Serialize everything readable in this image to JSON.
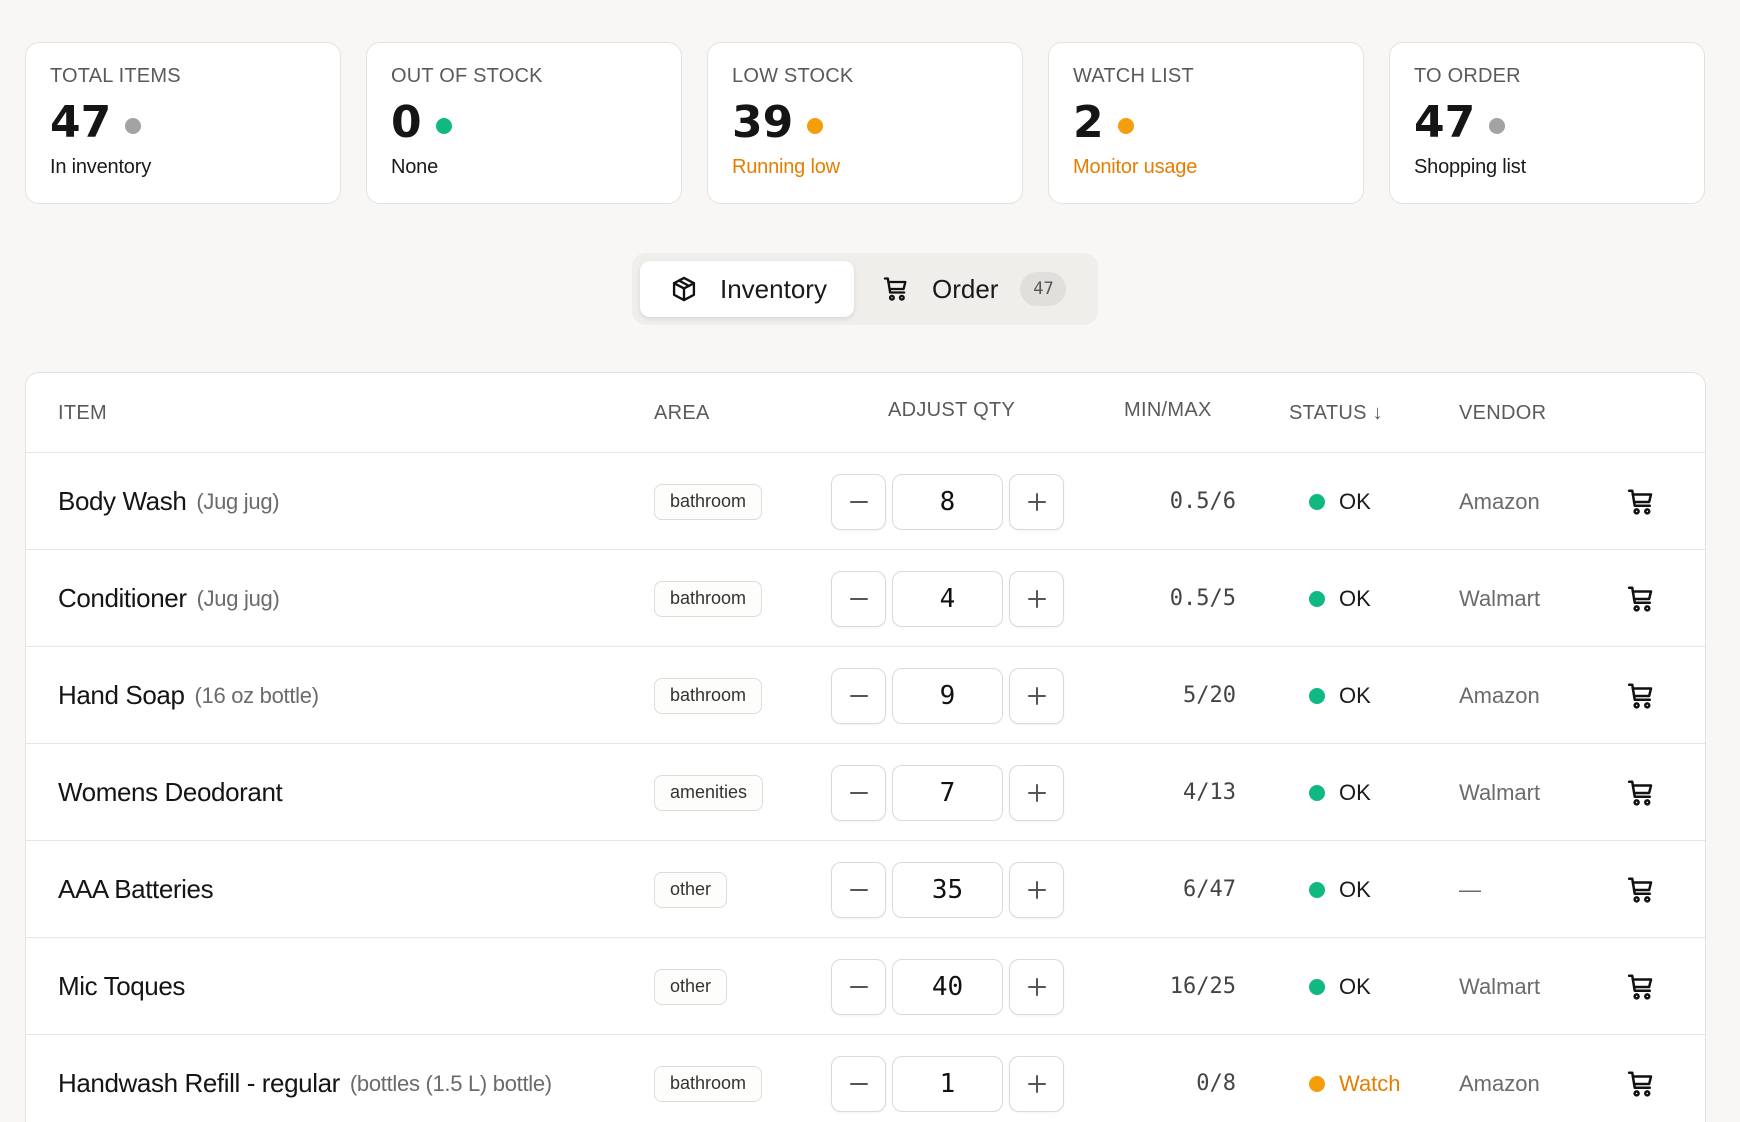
{
  "colors": {
    "green": "#10b981",
    "orange": "#f59e0b",
    "gray": "#a3a3a3",
    "orange_text": "#e67e00"
  },
  "stats": [
    {
      "label": "TOTAL ITEMS",
      "value": "47",
      "dot": "#a3a3a3",
      "sub": "In inventory",
      "sub_color": "#1a1a1a"
    },
    {
      "label": "OUT OF STOCK",
      "value": "0",
      "dot": "#10b981",
      "sub": "None",
      "sub_color": "#1a1a1a"
    },
    {
      "label": "LOW STOCK",
      "value": "39",
      "dot": "#f59e0b",
      "sub": "Running low",
      "sub_color": "#e67e00"
    },
    {
      "label": "WATCH LIST",
      "value": "2",
      "dot": "#f59e0b",
      "sub": "Monitor usage",
      "sub_color": "#e67e00"
    },
    {
      "label": "TO ORDER",
      "value": "47",
      "dot": "#a3a3a3",
      "sub": "Shopping list",
      "sub_color": "#1a1a1a"
    }
  ],
  "tabs": {
    "inventory": {
      "label": "Inventory",
      "icon": "box-icon"
    },
    "order": {
      "label": "Order",
      "icon": "cart-icon",
      "count": "47"
    }
  },
  "table": {
    "headers": {
      "item": "ITEM",
      "area": "AREA",
      "adjust": "ADJUST QTY",
      "minmax": "MIN/MAX",
      "status": "STATUS ↓",
      "vendor": "VENDOR"
    },
    "rows": [
      {
        "name": "Body Wash",
        "unit": "(Jug jug)",
        "area": "bathroom",
        "qty": "8",
        "minmax": "0.5/6",
        "status": "OK",
        "status_color": "#10b981",
        "status_text_color": "#1a1a1a",
        "vendor": "Amazon"
      },
      {
        "name": "Conditioner",
        "unit": "(Jug jug)",
        "area": "bathroom",
        "qty": "4",
        "minmax": "0.5/5",
        "status": "OK",
        "status_color": "#10b981",
        "status_text_color": "#1a1a1a",
        "vendor": "Walmart"
      },
      {
        "name": "Hand Soap",
        "unit": "(16 oz bottle)",
        "area": "bathroom",
        "qty": "9",
        "minmax": "5/20",
        "status": "OK",
        "status_color": "#10b981",
        "status_text_color": "#1a1a1a",
        "vendor": "Amazon"
      },
      {
        "name": "Womens Deodorant",
        "unit": "",
        "area": "amenities",
        "qty": "7",
        "minmax": "4/13",
        "status": "OK",
        "status_color": "#10b981",
        "status_text_color": "#1a1a1a",
        "vendor": "Walmart"
      },
      {
        "name": "AAA Batteries",
        "unit": "",
        "area": "other",
        "qty": "35",
        "minmax": "6/47",
        "status": "OK",
        "status_color": "#10b981",
        "status_text_color": "#1a1a1a",
        "vendor": "—"
      },
      {
        "name": "Mic Toques",
        "unit": "",
        "area": "other",
        "qty": "40",
        "minmax": "16/25",
        "status": "OK",
        "status_color": "#10b981",
        "status_text_color": "#1a1a1a",
        "vendor": "Walmart"
      },
      {
        "name": "Handwash Refill - regular",
        "unit": "(bottles (1.5 L) bottle)",
        "area": "bathroom",
        "qty": "1",
        "minmax": "0/8",
        "status": "Watch",
        "status_color": "#f59e0b",
        "status_text_color": "#e67e00",
        "vendor": "Amazon"
      }
    ]
  }
}
